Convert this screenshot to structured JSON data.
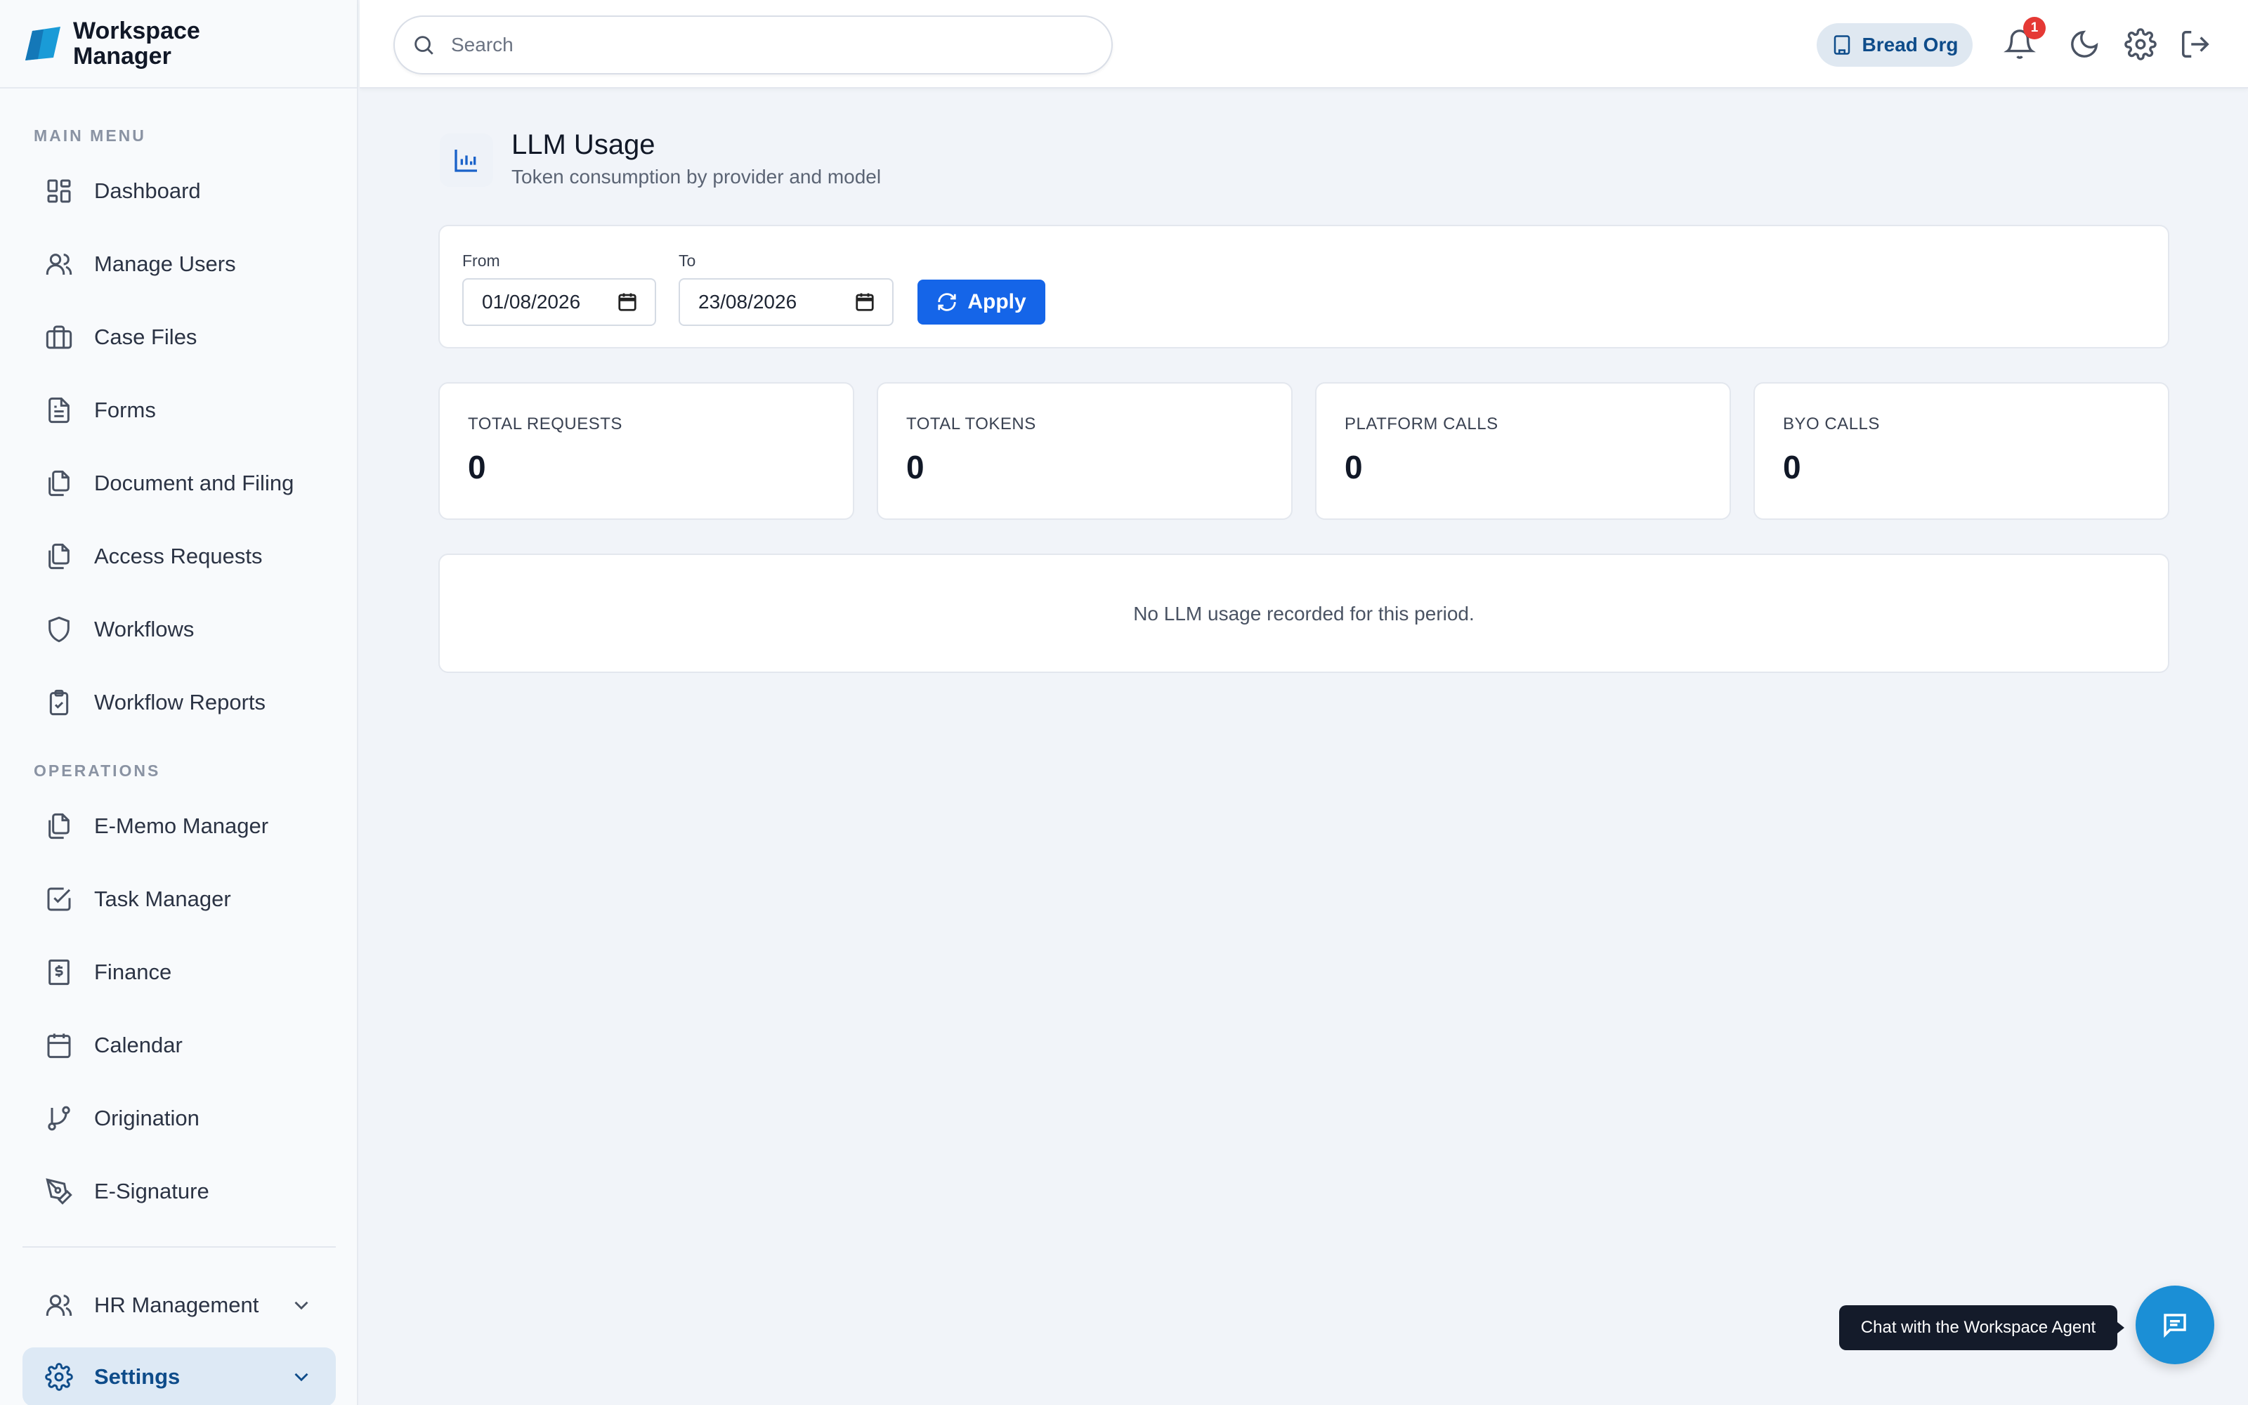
{
  "brand": {
    "name": "Workspace Manager"
  },
  "sidebar": {
    "main_menu_label": "MAIN MENU",
    "main_items": [
      {
        "label": "Dashboard",
        "icon": "dashboard-icon"
      },
      {
        "label": "Manage Users",
        "icon": "users-icon"
      },
      {
        "label": "Case Files",
        "icon": "briefcase-icon"
      },
      {
        "label": "Forms",
        "icon": "document-icon"
      },
      {
        "label": "Document and Filing",
        "icon": "files-icon"
      },
      {
        "label": "Access Requests",
        "icon": "files-icon"
      },
      {
        "label": "Workflows",
        "icon": "shield-icon"
      },
      {
        "label": "Workflow Reports",
        "icon": "clipboard-check-icon"
      }
    ],
    "operations_label": "OPERATIONS",
    "operations_items": [
      {
        "label": "E-Memo Manager",
        "icon": "files-icon"
      },
      {
        "label": "Task Manager",
        "icon": "checkbox-icon"
      },
      {
        "label": "Finance",
        "icon": "dollar-receipt-icon"
      },
      {
        "label": "Calendar",
        "icon": "calendar-icon"
      },
      {
        "label": "Origination",
        "icon": "git-branch-icon"
      },
      {
        "label": "E-Signature",
        "icon": "pen-tool-icon"
      }
    ],
    "bottom_items": [
      {
        "label": "HR Management",
        "icon": "users-icon",
        "expandable": true
      },
      {
        "label": "Settings",
        "icon": "gear-icon",
        "expandable": true,
        "active": true
      }
    ]
  },
  "topbar": {
    "search_placeholder": "Search",
    "org_name": "Bread Org",
    "notification_count": "1"
  },
  "page": {
    "title": "LLM Usage",
    "subtitle": "Token consumption by provider and model"
  },
  "filters": {
    "from_label": "From",
    "from_value": "01/08/2026",
    "to_label": "To",
    "to_value": "23/08/2026",
    "apply_label": "Apply"
  },
  "stats": [
    {
      "label": "TOTAL REQUESTS",
      "value": "0"
    },
    {
      "label": "TOTAL TOKENS",
      "value": "0"
    },
    {
      "label": "PLATFORM CALLS",
      "value": "0"
    },
    {
      "label": "BYO CALLS",
      "value": "0"
    }
  ],
  "empty_message": "No LLM usage recorded for this period.",
  "chat": {
    "tooltip": "Chat with the Workspace Agent"
  },
  "colors": {
    "accent": "#1565e8",
    "brand_blue": "#0e4c8a",
    "active_bg": "#dde9f5",
    "chat_button": "#1b8fd6",
    "badge_red": "#e53935"
  }
}
